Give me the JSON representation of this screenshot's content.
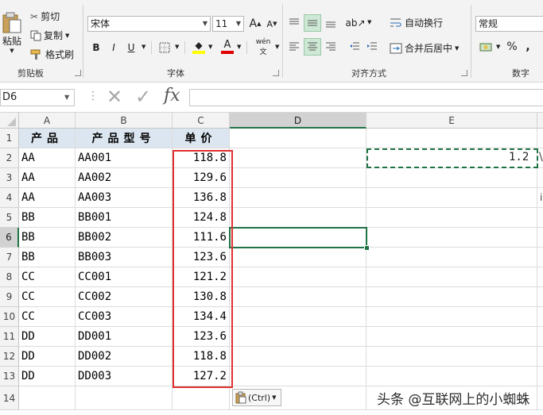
{
  "ribbon": {
    "clipboard": {
      "paste_label": "粘贴",
      "cut_label": "剪切",
      "copy_label": "复制",
      "format_painter_label": "格式刷",
      "group_label": "剪贴板"
    },
    "font": {
      "font_name": "宋体",
      "font_size": "11",
      "group_label": "字体",
      "bold": "B",
      "italic": "I",
      "underline": "U",
      "grow": "A",
      "shrink": "A",
      "font_color_letter": "A",
      "font_color": "#e00000",
      "fill_color": "#ffff00",
      "phonetic_label": "wén"
    },
    "alignment": {
      "wrap_text_label": "自动换行",
      "merge_center_label": "合并后居中",
      "group_label": "对齐方式"
    },
    "number": {
      "format_value": "常规",
      "percent": "%",
      "comma": ",",
      "group_label": "数字"
    }
  },
  "formula_bar": {
    "name_box": "D6",
    "fx": "fx",
    "formula": ""
  },
  "columns": [
    "A",
    "B",
    "C",
    "D",
    "E"
  ],
  "rows": [
    "1",
    "2",
    "3",
    "4",
    "5",
    "6",
    "7",
    "8",
    "9",
    "10",
    "11",
    "12",
    "13",
    "14"
  ],
  "sheet": {
    "headers": [
      "产品",
      "产品型号",
      "单价"
    ],
    "data": [
      [
        "AA",
        "AA001",
        "118.8"
      ],
      [
        "AA",
        "AA002",
        "129.6"
      ],
      [
        "AA",
        "AA003",
        "136.8"
      ],
      [
        "BB",
        "BB001",
        "124.8"
      ],
      [
        "BB",
        "BB002",
        "111.6"
      ],
      [
        "BB",
        "BB003",
        "123.6"
      ],
      [
        "CC",
        "CC001",
        "121.2"
      ],
      [
        "CC",
        "CC002",
        "130.8"
      ],
      [
        "CC",
        "CC003",
        "134.4"
      ],
      [
        "DD",
        "DD001",
        "123.6"
      ],
      [
        "DD",
        "DD002",
        "118.8"
      ],
      [
        "DD",
        "DD003",
        "127.2"
      ]
    ],
    "e2_value": "1.2",
    "copied_cell_color": "#217346",
    "highlight_color": "#e03030"
  },
  "paste_options": {
    "label": "(Ctrl)"
  },
  "watermark": "头条 @互联网上的小蜘蛛"
}
